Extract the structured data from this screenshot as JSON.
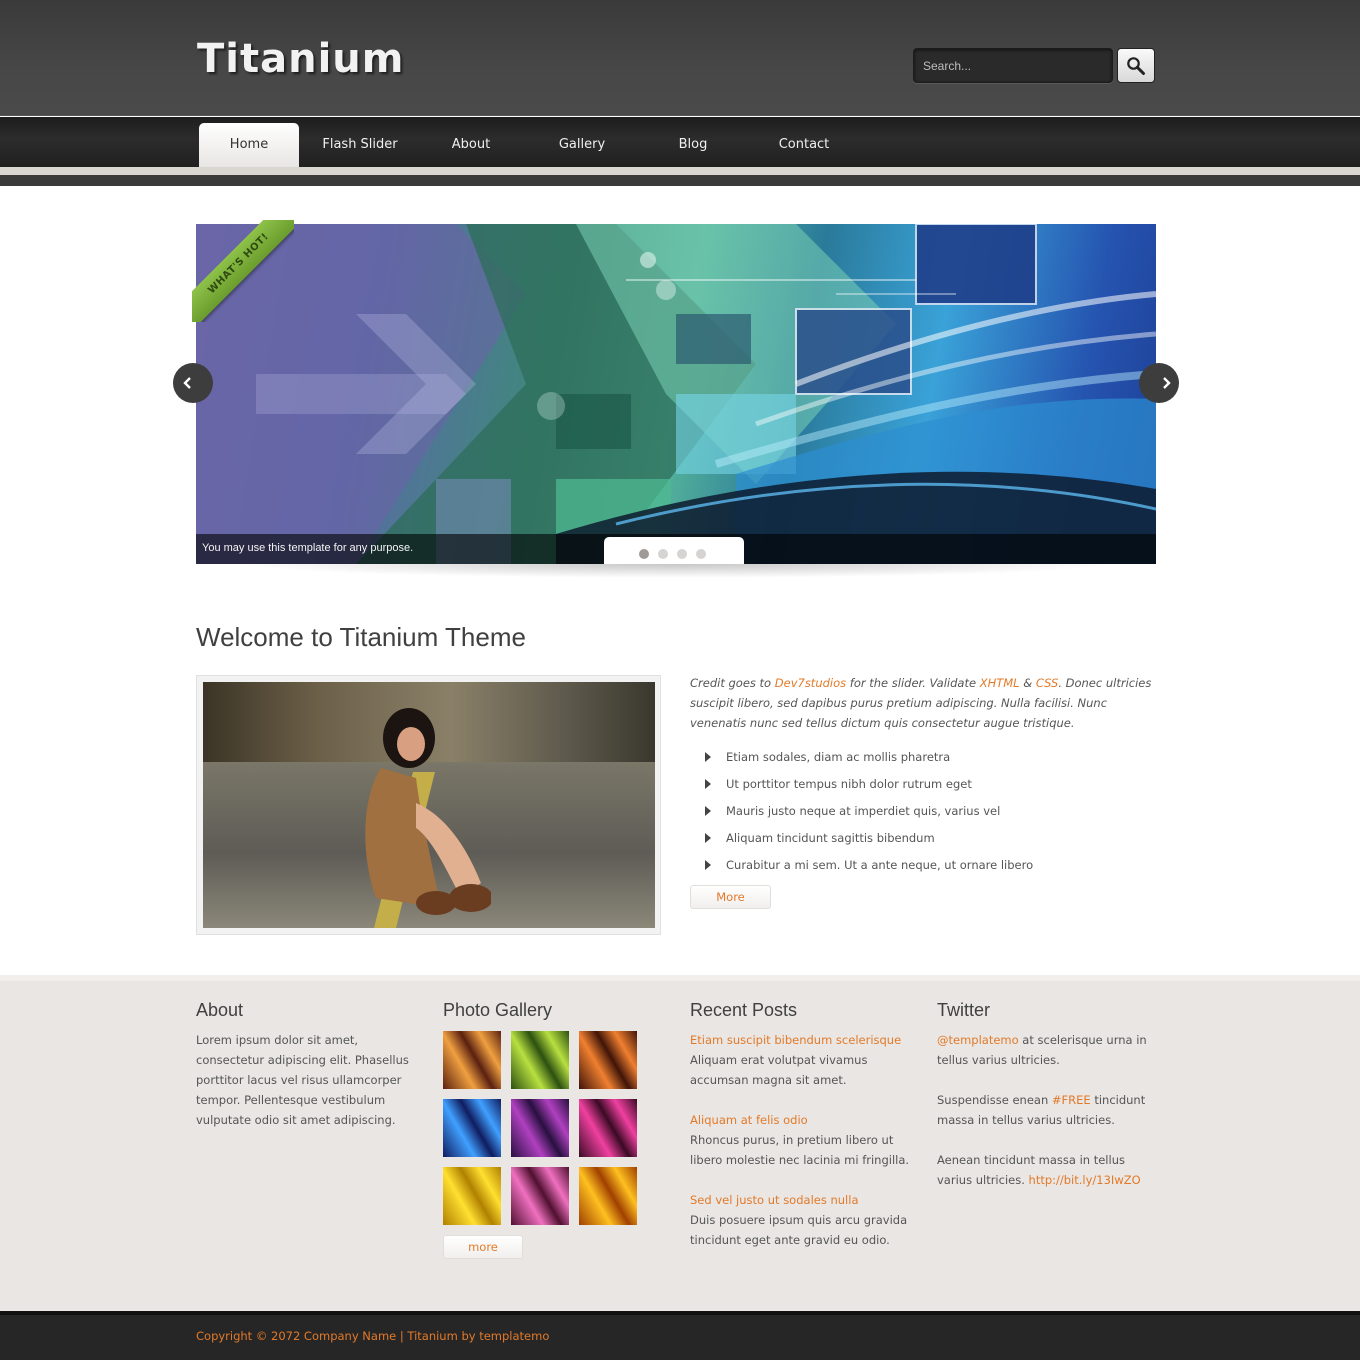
{
  "header": {
    "logo_text": "Titanium",
    "search": {
      "placeholder": "Search..."
    }
  },
  "nav": {
    "items": [
      {
        "label": "Home",
        "active": true
      },
      {
        "label": "Flash Slider"
      },
      {
        "label": "About"
      },
      {
        "label": "Gallery"
      },
      {
        "label": "Blog"
      },
      {
        "label": "Contact"
      }
    ]
  },
  "slider": {
    "badge_text": "WHAT'S HOT!",
    "caption": "You may use this template for any purpose.",
    "dots_total": 4,
    "active_dot": 1
  },
  "welcome": {
    "title": "Welcome to Titanium Theme",
    "intro": {
      "t1": "Credit goes to ",
      "link1": "Dev7studios",
      "t2": " for the slider. Validate ",
      "link2": "XHTML",
      "t3": " & ",
      "link3": "CSS",
      "t4": ". Donec ultricies suscipit libero, sed dapibus purus pretium adipiscing. Nulla facilisi. Nunc venenatis nunc sed tellus dictum quis consectetur augue tristique."
    },
    "bullets": [
      "Etiam sodales, diam ac mollis pharetra",
      "Ut porttitor tempus nibh dolor rutrum eget",
      "Mauris justo neque at imperdiet quis, varius vel",
      "Aliquam tincidunt sagittis bibendum",
      "Curabitur a mi sem. Ut a ante neque, ut ornare libero"
    ],
    "more_label": "More"
  },
  "footer": {
    "about": {
      "title": "About",
      "text": "Lorem ipsum dolor sit amet, consectetur adipiscing elit. Phasellus porttitor lacus vel risus ullamcorper tempor. Pellentesque vestibulum vulputate odio sit amet adipiscing."
    },
    "gallery": {
      "title": "Photo Gallery",
      "more_label": "more",
      "thumb_colors": [
        [
          "#f0a040",
          "#5a2010"
        ],
        [
          "#b8e040",
          "#2c5010"
        ],
        [
          "#f08030",
          "#401408"
        ],
        [
          "#40a0ff",
          "#101c60"
        ],
        [
          "#b040c0",
          "#281040"
        ],
        [
          "#f040a0",
          "#3a0a24"
        ],
        [
          "#ffe030",
          "#b08000"
        ],
        [
          "#f070c0",
          "#501030"
        ],
        [
          "#ffc020",
          "#a04000"
        ]
      ]
    },
    "recent_posts": {
      "title": "Recent Posts",
      "posts": [
        {
          "title": "Etiam suscipit bibendum scelerisque",
          "text": "Aliquam erat volutpat vivamus accumsan magna sit amet."
        },
        {
          "title": "Aliquam at felis odio",
          "text": "Rhoncus purus, in pretium libero ut libero molestie nec lacinia mi fringilla."
        },
        {
          "title": "Sed vel justo ut sodales nulla",
          "text": "Duis posuere ipsum quis arcu gravida tincidunt eget ante gravid eu odio."
        }
      ]
    },
    "twitter": {
      "title": "Twitter",
      "tweet1": {
        "handle": "@templatemo",
        "text": " at scelerisque urna in tellus varius ultricies."
      },
      "tweet2": {
        "pre": "Suspendisse enean ",
        "tag": "#FREE",
        "post": " tincidunt massa in tellus varius ultricies."
      },
      "tweet3": {
        "text": "Aenean tincidunt massa in tellus varius ultricies. ",
        "link": "http://bit.ly/13IwZO"
      }
    }
  },
  "copyright": "Copyright © 2072 Company Name | Titanium by templatemo",
  "colors": {
    "accent": "#e27a2a",
    "header_bg": "#444444",
    "footer_bg": "#e9e6e3"
  }
}
